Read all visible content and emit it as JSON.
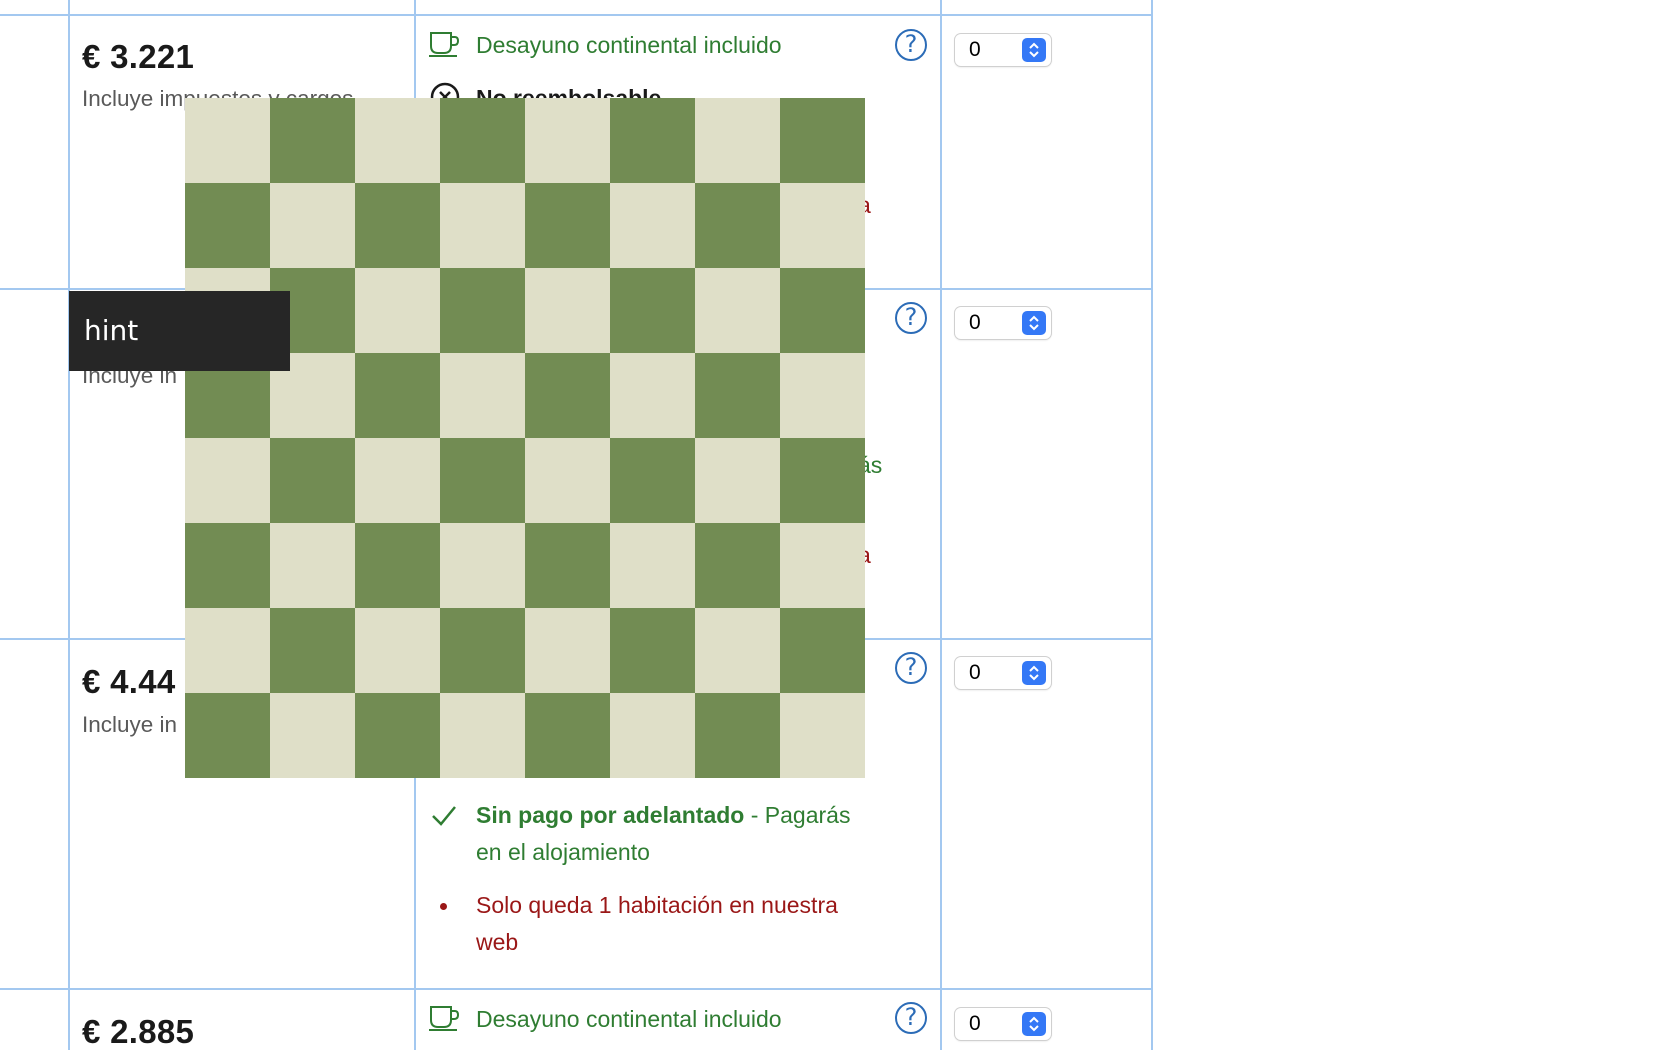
{
  "rows": [
    {
      "price": "€ 3.221",
      "taxes": "Incluye impuestos y cargos",
      "breakfast": "Desayuno continental incluido",
      "cancel": "No reembolsable",
      "partial_red": "a",
      "qty": "0"
    },
    {
      "taxes_partial": "Incluye in",
      "partial_green": "ás",
      "partial_red": "a",
      "qty": "0"
    },
    {
      "price_partial": "€ 4.44",
      "taxes_partial": "Incluye in",
      "nopay_bold": "Sin pago por adelantado",
      "nopay_rest": " - Pagarás",
      "nopay_line2": "en el alojamiento",
      "scarcity_line1": "Solo queda 1 habitación en nuestra",
      "scarcity_line2": "web",
      "qty": "0"
    },
    {
      "price": "€ 2.885",
      "breakfast": "Desayuno continental incluido",
      "qty": "0"
    }
  ],
  "hint": {
    "label": "hint"
  },
  "colors": {
    "grid_line": "#a3c8f0",
    "green_text": "#2f7d32",
    "red_text": "#9a1717",
    "help_blue": "#2c6cb7",
    "board_light": "#dfdfc8",
    "board_dark": "#728c53",
    "hint_bg": "#262626"
  },
  "icons": [
    "cup-icon",
    "close-circle-icon",
    "check-icon",
    "help-icon",
    "bullet-icon",
    "chevron-updown-icon"
  ]
}
